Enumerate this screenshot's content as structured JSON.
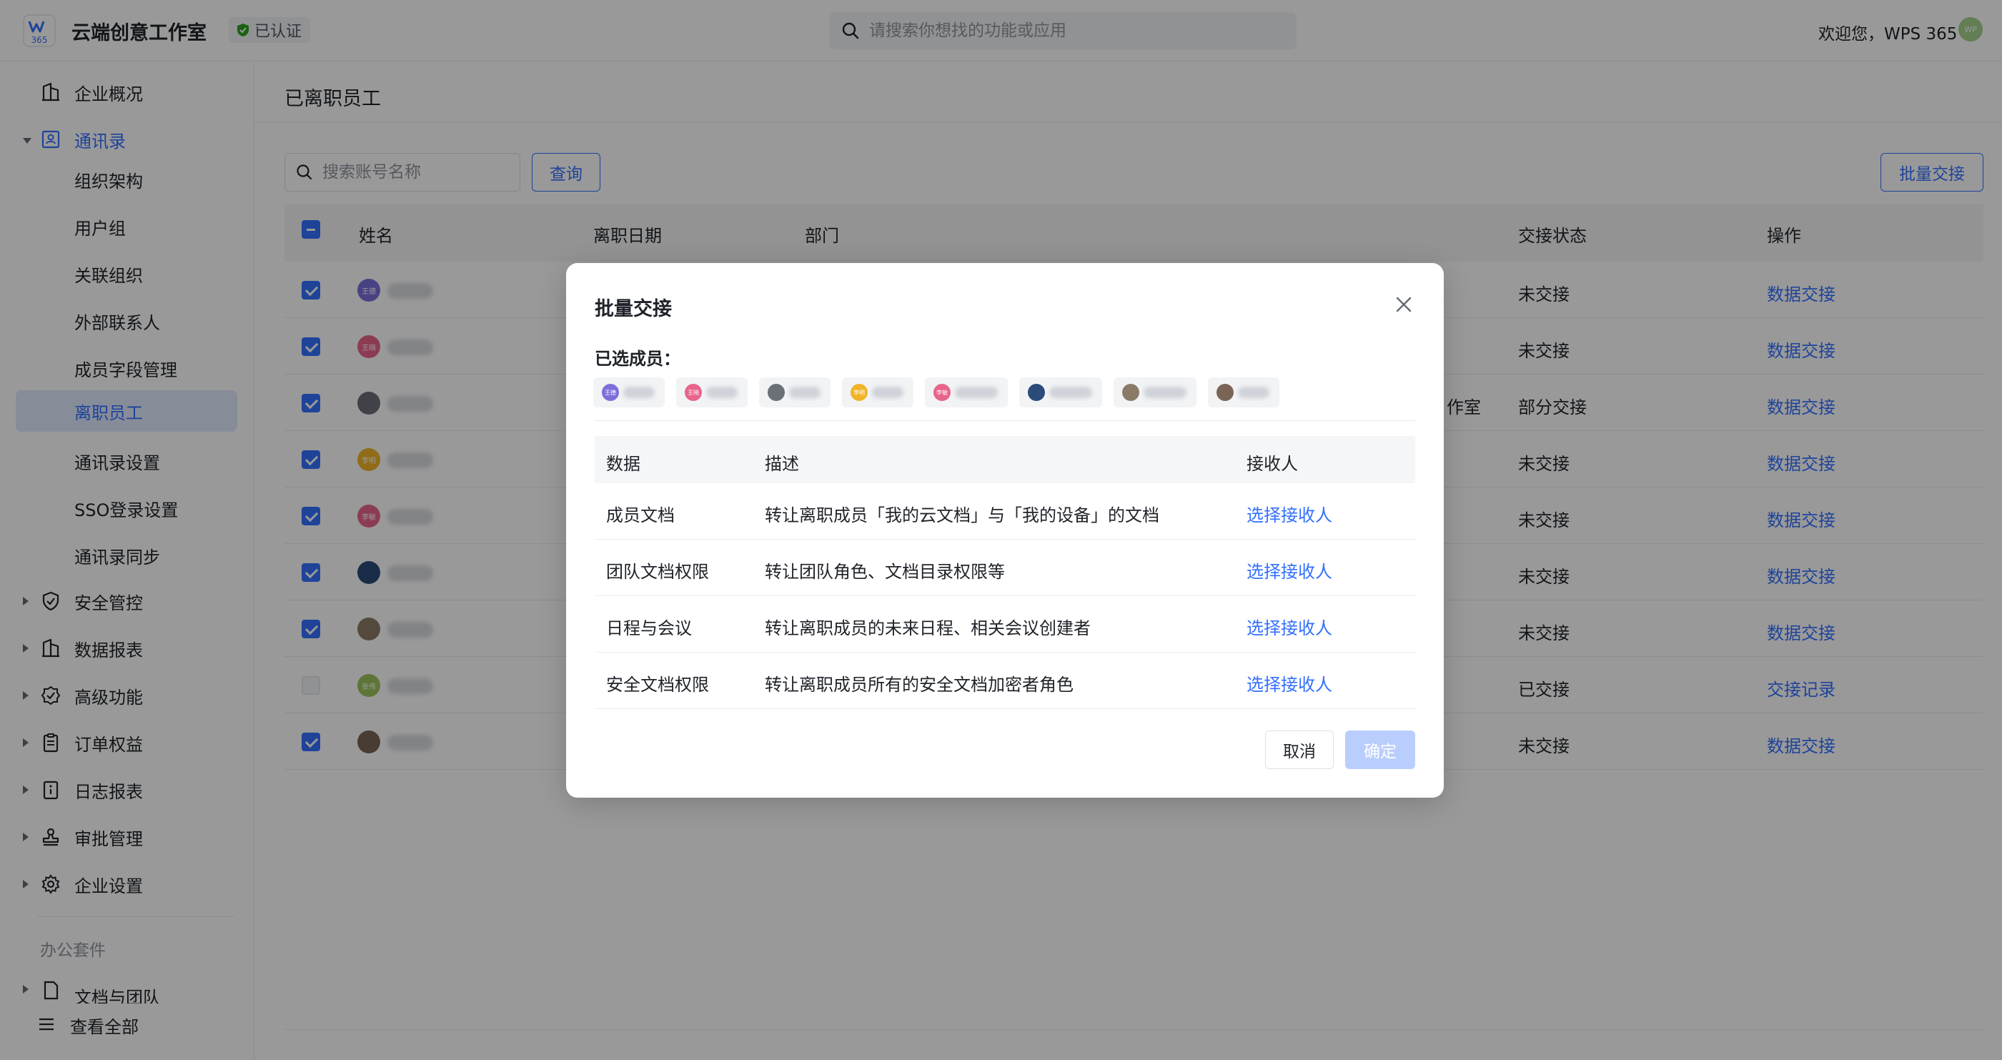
{
  "header": {
    "org_name": "云端创意工作室",
    "verified_label": "已认证",
    "search_placeholder": "请搜索你想找的功能或应用",
    "welcome": "欢迎您，WPS 365",
    "avatar_text": "WP"
  },
  "sidebar": {
    "items": [
      {
        "label": "企业概况",
        "icon": "building-icon"
      },
      {
        "label": "通讯录",
        "icon": "contacts-icon"
      },
      {
        "label": "组织架构"
      },
      {
        "label": "用户组"
      },
      {
        "label": "关联组织"
      },
      {
        "label": "外部联系人"
      },
      {
        "label": "成员字段管理"
      },
      {
        "label": "离职员工"
      },
      {
        "label": "通讯录设置"
      },
      {
        "label": "SSO登录设置"
      },
      {
        "label": "通讯录同步"
      },
      {
        "label": "安全管控",
        "icon": "shield-icon"
      },
      {
        "label": "数据报表",
        "icon": "report-icon"
      },
      {
        "label": "高级功能",
        "icon": "badge-check-icon"
      },
      {
        "label": "订单权益",
        "icon": "clipboard-icon"
      },
      {
        "label": "日志报表",
        "icon": "info-doc-icon"
      },
      {
        "label": "审批管理",
        "icon": "stamp-icon"
      },
      {
        "label": "企业设置",
        "icon": "gear-icon"
      }
    ],
    "section_office": "办公套件",
    "docs_team": "文档与团队",
    "view_all": "查看全部"
  },
  "main": {
    "page_title": "已离职员工",
    "search_placeholder": "搜索账号名称",
    "query_button": "查询",
    "batch_button": "批量交接",
    "columns": {
      "name": "姓名",
      "leave_date": "离职日期",
      "department": "部门",
      "status": "交接状态",
      "action": "操作"
    },
    "rows": [
      {
        "checked": true,
        "avatar_color": "#7b6fd9",
        "avatar_text": "王德",
        "status": "未交接",
        "action": "数据交接",
        "dept": ""
      },
      {
        "checked": true,
        "avatar_color": "#e8648a",
        "avatar_text": "王晓",
        "status": "未交接",
        "action": "数据交接",
        "dept": ""
      },
      {
        "checked": true,
        "avatar_color": "#6b6f78",
        "avatar_text": "",
        "status": "部分交接",
        "action": "数据交接",
        "dept": "作室"
      },
      {
        "checked": true,
        "avatar_color": "#f0b429",
        "avatar_text": "李明",
        "status": "未交接",
        "action": "数据交接",
        "dept": ""
      },
      {
        "checked": true,
        "avatar_color": "#e8648a",
        "avatar_text": "李敏",
        "status": "未交接",
        "action": "数据交接",
        "dept": ""
      },
      {
        "checked": true,
        "avatar_color": "#2b4b7a",
        "avatar_text": "",
        "status": "未交接",
        "action": "数据交接",
        "dept": ""
      },
      {
        "checked": true,
        "avatar_color": "#8a7a66",
        "avatar_text": "",
        "status": "未交接",
        "action": "数据交接",
        "dept": ""
      },
      {
        "checked": false,
        "avatar_color": "#9bc45a",
        "avatar_text": "张伟",
        "status": "已交接",
        "action": "交接记录",
        "dept": ""
      },
      {
        "checked": true,
        "avatar_color": "#7a6455",
        "avatar_text": "",
        "status": "未交接",
        "action": "数据交接",
        "dept": ""
      }
    ]
  },
  "modal": {
    "title": "批量交接",
    "selected_label": "已选成员：",
    "members": [
      {
        "avatar_color": "#7b6fd9",
        "avatar_text": "王德"
      },
      {
        "avatar_color": "#e8648a",
        "avatar_text": "王晓"
      },
      {
        "avatar_color": "#6b6f78",
        "avatar_text": ""
      },
      {
        "avatar_color": "#f0b429",
        "avatar_text": "李明"
      },
      {
        "avatar_color": "#e8648a",
        "avatar_text": "李敏"
      },
      {
        "avatar_color": "#2b4b7a",
        "avatar_text": ""
      },
      {
        "avatar_color": "#8a7a66",
        "avatar_text": ""
      },
      {
        "avatar_color": "#7a6455",
        "avatar_text": ""
      }
    ],
    "columns": {
      "data": "数据",
      "desc": "描述",
      "receiver": "接收人"
    },
    "rows": [
      {
        "data": "成员文档",
        "desc": "转让离职成员「我的云文档」与「我的设备」的文档",
        "receiver": "选择接收人"
      },
      {
        "data": "团队文档权限",
        "desc": "转让团队角色、文档目录权限等",
        "receiver": "选择接收人"
      },
      {
        "data": "日程与会议",
        "desc": "转让离职成员的未来日程、相关会议创建者",
        "receiver": "选择接收人"
      },
      {
        "data": "安全文档权限",
        "desc": "转让离职成员所有的安全文档加密者角色",
        "receiver": "选择接收人"
      }
    ],
    "cancel": "取消",
    "confirm": "确定"
  },
  "colors": {
    "accent": "#3370ff",
    "selected_bg": "#e1eaff",
    "confirm_disabled": "#bacefd",
    "verified_green": "#2ea121"
  }
}
